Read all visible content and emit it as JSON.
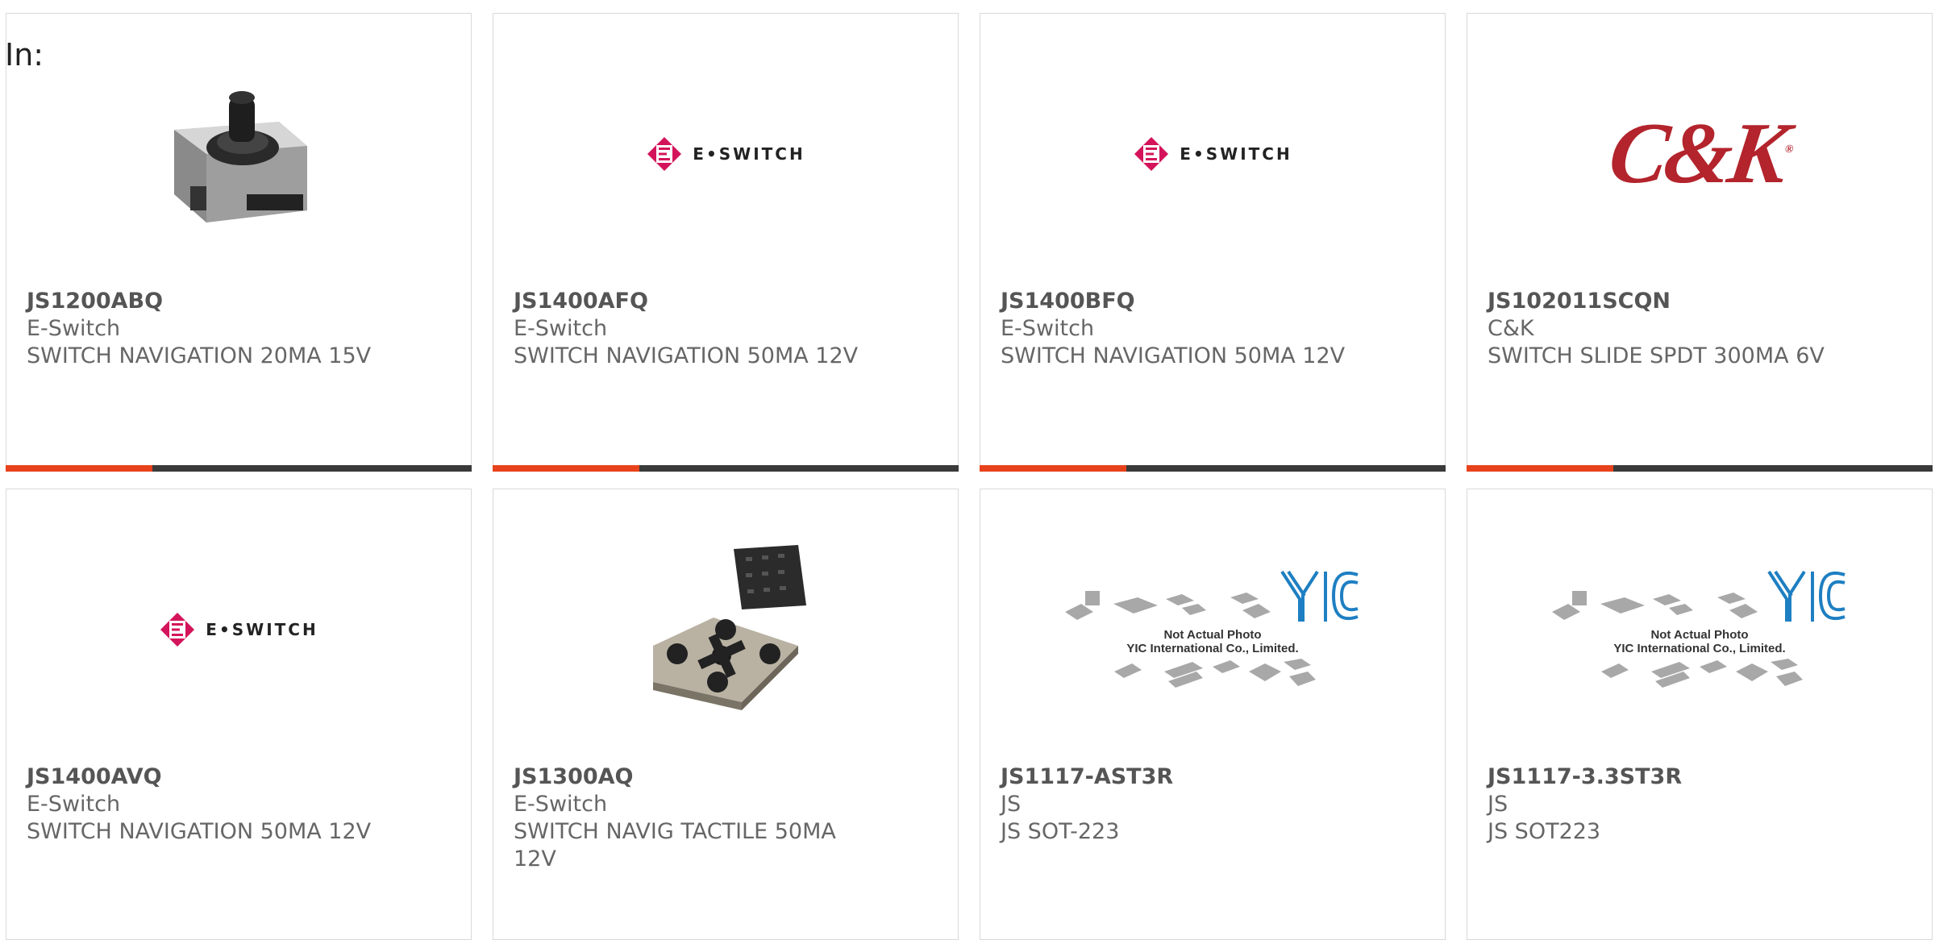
{
  "label": "In:",
  "colors": {
    "accent": "#e8421c",
    "bar": "#3a3a3a",
    "eswitch_red": "#d4145a",
    "ck_red": "#b3242c",
    "yic_blue": "#1e7fc2"
  },
  "cards": [
    {
      "part": "JS1200ABQ",
      "manufacturer": "E-Switch",
      "description": "SWITCH NAVIGATION 20MA 15V",
      "image": "product-photo-switch"
    },
    {
      "part": "JS1400AFQ",
      "manufacturer": "E-Switch",
      "description": "SWITCH NAVIGATION 50MA 12V",
      "image": "eswitch-logo"
    },
    {
      "part": "JS1400BFQ",
      "manufacturer": "E-Switch",
      "description": "SWITCH NAVIGATION 50MA 12V",
      "image": "eswitch-logo"
    },
    {
      "part": "JS102011SCQN",
      "manufacturer": "C&K",
      "description": "SWITCH SLIDE SPDT 300MA 6V",
      "image": "ck-logo"
    },
    {
      "part": "JS1400AVQ",
      "manufacturer": "E-Switch",
      "description": "SWITCH NAVIGATION 50MA 12V",
      "image": "eswitch-logo"
    },
    {
      "part": "JS1300AQ",
      "manufacturer": "E-Switch",
      "description": "SWITCH NAVIG TACTILE 50MA 12V",
      "image": "product-photo-tactile"
    },
    {
      "part": "JS1117-AST3R",
      "manufacturer": "JS",
      "description": "JS SOT-223",
      "image": "not-actual-photo"
    },
    {
      "part": "JS1117-3.3ST3R",
      "manufacturer": "JS",
      "description": "JS SOT223",
      "image": "not-actual-photo"
    }
  ],
  "logos": {
    "eswitch": "E•SWITCH",
    "ck": "C&K",
    "yic_line1": "Not Actual Photo",
    "yic_line2": "YIC International Co., Limited."
  }
}
